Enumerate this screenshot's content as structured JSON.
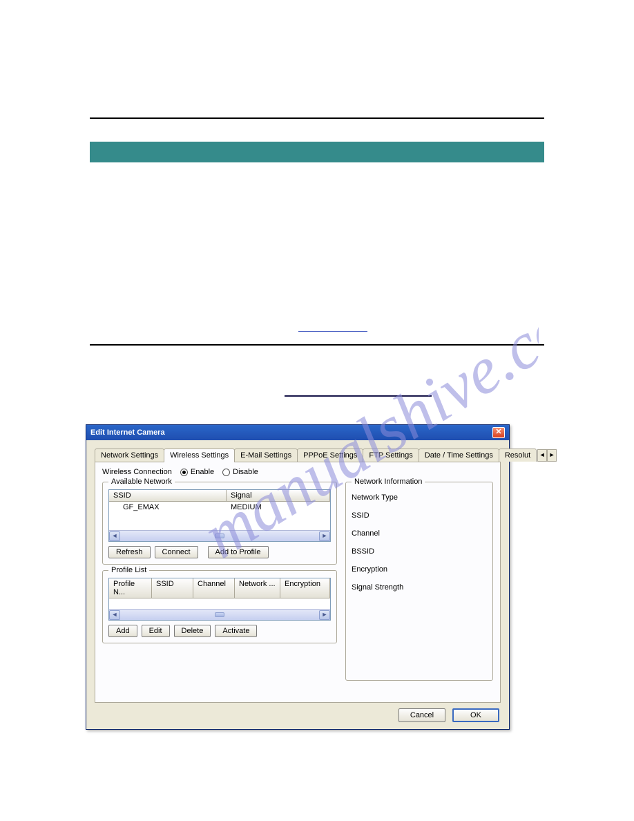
{
  "window": {
    "title": "Edit Internet Camera"
  },
  "tabs": [
    "Network Settings",
    "Wireless Settings",
    "E-Mail Settings",
    "PPPoE Settings",
    "FTP Settings",
    "Date / Time Settings",
    "Resolut"
  ],
  "active_tab_index": 1,
  "wireless": {
    "label": "Wireless Connection",
    "enable_label": "Enable",
    "disable_label": "Disable",
    "enabled": true
  },
  "available_network": {
    "group_label": "Available Network",
    "columns": [
      "SSID",
      "Signal"
    ],
    "rows": [
      {
        "ssid": "GF_EMAX",
        "signal": "MEDIUM"
      }
    ],
    "buttons": {
      "refresh": "Refresh",
      "connect": "Connect",
      "add_to_profile": "Add to Profile"
    }
  },
  "profile_list": {
    "group_label": "Profile List",
    "columns": [
      "Profile N...",
      "SSID",
      "Channel",
      "Network ...",
      "Encryption"
    ],
    "rows": [],
    "buttons": {
      "add": "Add",
      "edit": "Edit",
      "delete": "Delete",
      "activate": "Activate"
    }
  },
  "network_information": {
    "group_label": "Network Information",
    "fields": [
      "Network Type",
      "SSID",
      "Channel",
      "BSSID",
      "Encryption",
      "Signal Strength"
    ]
  },
  "footer": {
    "cancel": "Cancel",
    "ok": "OK"
  }
}
